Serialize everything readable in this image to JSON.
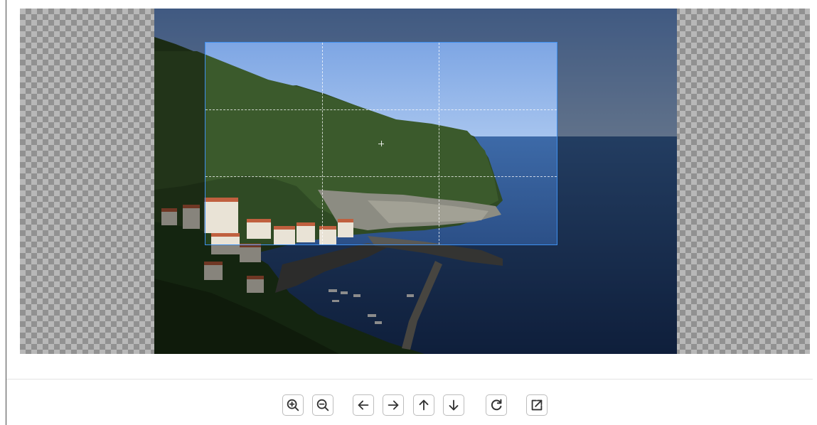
{
  "toolbar": {
    "buttons": [
      {
        "name": "zoom-in",
        "icon": "zoom-in-icon"
      },
      {
        "name": "zoom-out",
        "icon": "zoom-out-icon"
      },
      {
        "name": "move-left",
        "icon": "arrow-left-icon"
      },
      {
        "name": "move-right",
        "icon": "arrow-right-icon"
      },
      {
        "name": "move-up",
        "icon": "arrow-up-icon"
      },
      {
        "name": "move-down",
        "icon": "arrow-down-icon"
      },
      {
        "name": "rotate",
        "icon": "rotate-cw-icon"
      },
      {
        "name": "open-external",
        "icon": "external-link-icon"
      }
    ]
  },
  "colors": {
    "accent": "#3d8ff0",
    "icon": "#333333",
    "button_border": "#bdbdbd"
  }
}
